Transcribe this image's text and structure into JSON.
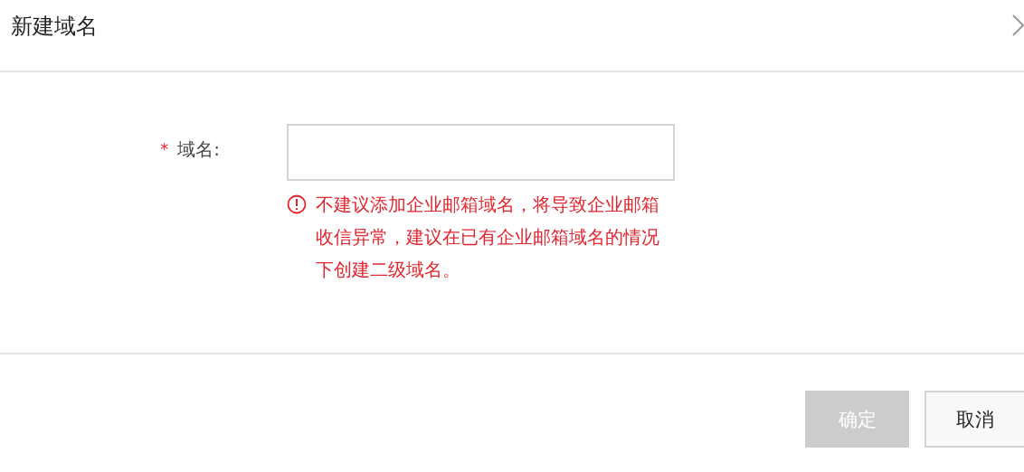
{
  "dialog": {
    "title": "新建域名"
  },
  "form": {
    "field": {
      "required_mark": "*",
      "label": "域名:",
      "error": "不建议添加企业邮箱域名，将导致企业邮箱收信异常，建议在已有企业邮箱域名的情况下创建二级域名。"
    }
  },
  "buttons": [
    {
      "label": "确定",
      "kind": "primary",
      "disabled": true
    },
    {
      "label": "取消",
      "kind": "secondary",
      "disabled": false
    }
  ]
}
